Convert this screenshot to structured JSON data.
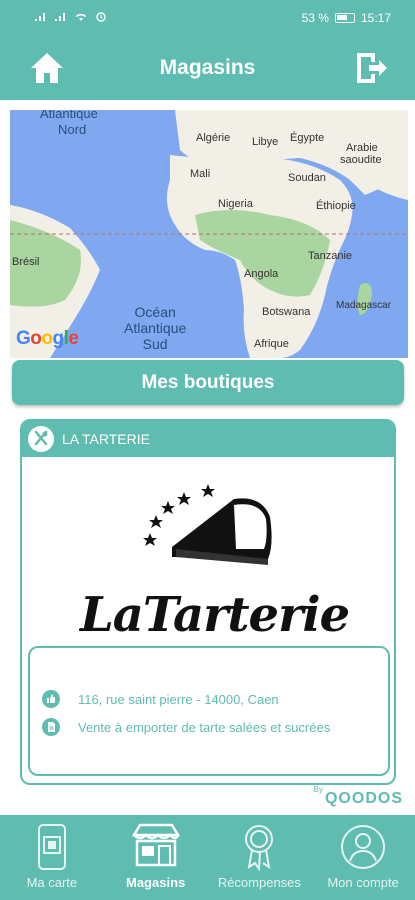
{
  "status_bar": {
    "battery": "53 %",
    "time": "15:17"
  },
  "header": {
    "title": "Magasins",
    "home_icon": "home-icon",
    "logout_icon": "logout-icon"
  },
  "map": {
    "labels": {
      "atlantique_nord_1": "Atlantique",
      "atlantique_nord_2": "Nord",
      "algerie": "Algérie",
      "libye": "Libye",
      "egypte": "Égypte",
      "arabie_1": "Arabie",
      "arabie_2": "saoudite",
      "mali": "Mali",
      "soudan": "Soudan",
      "nigeria": "Nigeria",
      "ethiopie": "Éthiopie",
      "bresil": "Brésil",
      "tanzanie": "Tanzanie",
      "angola": "Angola",
      "madagascar": "Madagascar",
      "botswana": "Botswana",
      "afrique": "Afrique",
      "ocean_1": "Océan",
      "ocean_2": "Atlantique",
      "ocean_3": "Sud"
    },
    "google": "Google"
  },
  "section": {
    "title": "Mes boutiques"
  },
  "store": {
    "name": "LA TARTERIE",
    "logo_text": "LaTarterie",
    "address": "116, rue saint pierre - 14000, Caen",
    "description": "Vente à emporter de tarte salées et sucrées"
  },
  "credit": {
    "by": "By",
    "brand": "QOODOS"
  },
  "nav": [
    {
      "label": "Ma carte",
      "icon": "card-icon"
    },
    {
      "label": "Magasins",
      "icon": "store-icon"
    },
    {
      "label": "Récompenses",
      "icon": "medal-icon"
    },
    {
      "label": "Mon compte",
      "icon": "account-icon"
    }
  ],
  "colors": {
    "primary": "#5fbcb0",
    "ocean": "#7fa8f0",
    "land": "#f2efe6",
    "forest": "#a8d5a0"
  }
}
